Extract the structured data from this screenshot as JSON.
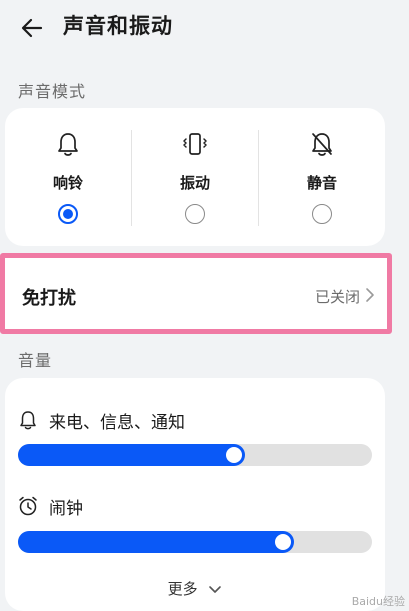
{
  "header": {
    "title": "声音和振动"
  },
  "sound_mode": {
    "section_label": "声音模式",
    "options": [
      {
        "label": "响铃",
        "icon": "bell-icon",
        "selected": true
      },
      {
        "label": "振动",
        "icon": "vibrate-icon",
        "selected": false
      },
      {
        "label": "静音",
        "icon": "bell-off-icon",
        "selected": false
      }
    ]
  },
  "dnd": {
    "title": "免打扰",
    "status": "已关闭"
  },
  "volume": {
    "section_label": "音量",
    "items": [
      {
        "label": "来电、信息、通知",
        "icon": "bell-icon",
        "level": 0.64
      },
      {
        "label": "闹钟",
        "icon": "alarm-clock-icon",
        "level": 0.78
      }
    ],
    "more_label": "更多"
  },
  "colors": {
    "accent": "#0a59f7",
    "highlight": "#f07aa4",
    "background": "#f1f3f5"
  },
  "watermark": "Baidu经验"
}
